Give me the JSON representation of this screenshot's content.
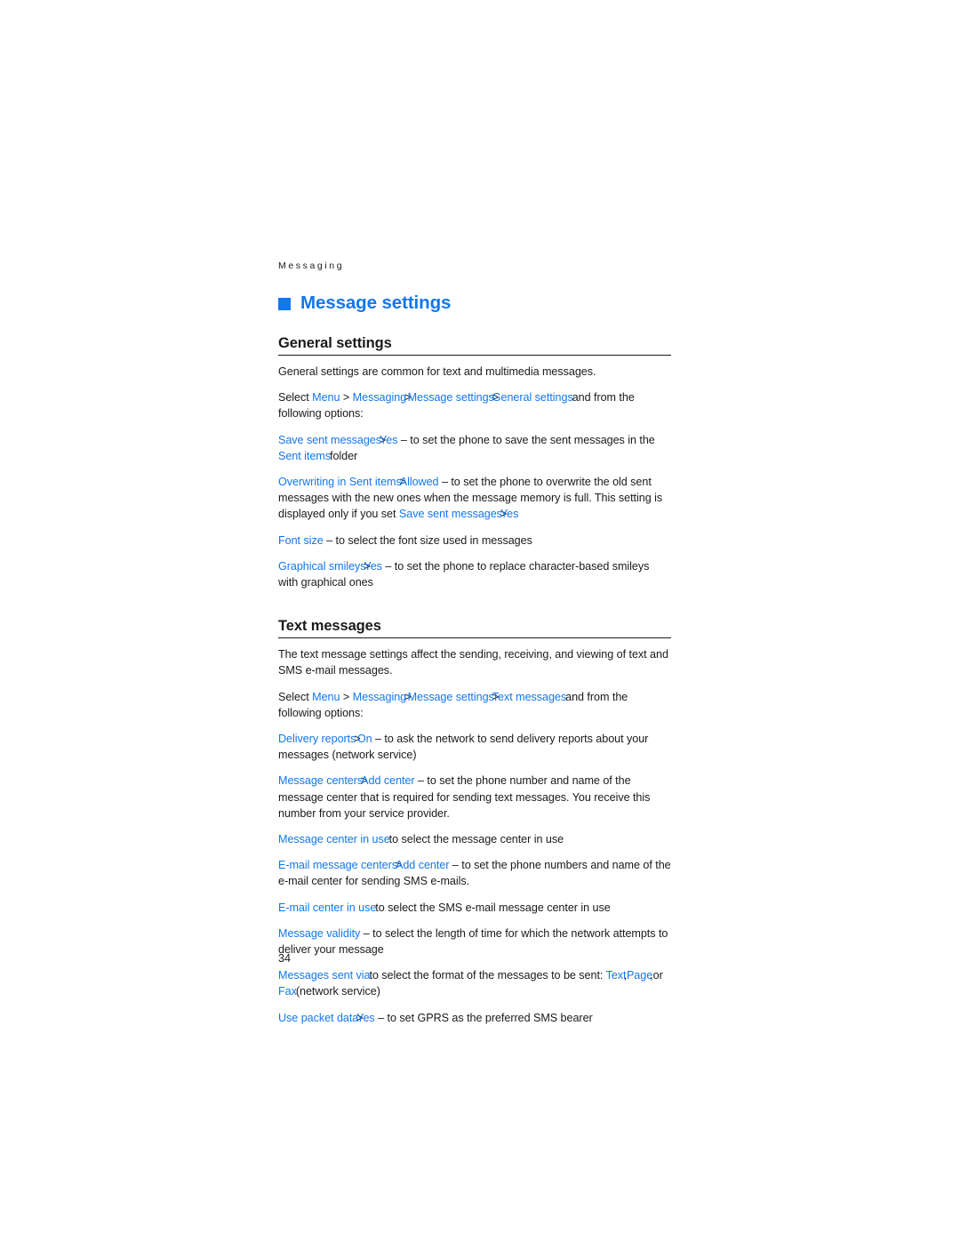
{
  "page": {
    "running_head": "Messaging",
    "page_number": "34",
    "accent_color": "#1277ee",
    "text_color": "#1a1a1a",
    "background_color": "#ffffff"
  },
  "chapter": {
    "bullet": "square-bullet",
    "title": "Message settings"
  },
  "sections": [
    {
      "heading": "General settings",
      "paragraphs": [
        {
          "id": "general-intro",
          "runs": [
            {
              "style": "plain",
              "text": "General settings are common for text and multimedia messages."
            }
          ]
        },
        {
          "id": "general-path",
          "runs": [
            {
              "style": "plain",
              "text": "Select "
            },
            {
              "style": "term",
              "text": "Menu"
            },
            {
              "style": "plain",
              "text": " > "
            },
            {
              "style": "term",
              "text": "Messaging"
            },
            {
              "style": "sep",
              "text": ">"
            },
            {
              "style": "term",
              "text": " Message settings"
            },
            {
              "style": "sep",
              "text": ">"
            },
            {
              "style": "term",
              "text": "General settings"
            },
            {
              "style": "collide",
              "text": "and from the following options:"
            }
          ]
        },
        {
          "id": "save-sent-messages",
          "runs": [
            {
              "style": "term",
              "text": "Save sent messages"
            },
            {
              "style": "sep",
              "text": ">"
            },
            {
              "style": "term",
              "text": "Yes"
            },
            {
              "style": "plain",
              "text": " – to set the phone to save the sent messages in the "
            },
            {
              "style": "term",
              "text": "Sent items"
            },
            {
              "style": "collide",
              "text": "folder"
            }
          ]
        },
        {
          "id": "overwriting-in-sent-items",
          "runs": [
            {
              "style": "term",
              "text": "Overwriting in Sent items"
            },
            {
              "style": "sep",
              "text": ">"
            },
            {
              "style": "term",
              "text": "Allowed"
            },
            {
              "style": "plain",
              "text": " – to set the phone to overwrite the old sent messages with the new ones when the message memory is full. This setting is displayed only if you set "
            },
            {
              "style": "term",
              "text": "Save sent messages"
            },
            {
              "style": "sep",
              "text": ">"
            },
            {
              "style": "term",
              "text": "Yes"
            }
          ]
        },
        {
          "id": "font-size",
          "runs": [
            {
              "style": "term",
              "text": "Font size"
            },
            {
              "style": "plain",
              "text": " – to select the font size used in messages"
            }
          ]
        },
        {
          "id": "graphical-smileys",
          "runs": [
            {
              "style": "term",
              "text": "Graphical smileys"
            },
            {
              "style": "sep",
              "text": ">"
            },
            {
              "style": "term",
              "text": "Yes"
            },
            {
              "style": "plain",
              "text": " – to set the phone to replace character-based smileys with graphical ones"
            }
          ]
        }
      ]
    },
    {
      "heading": "Text messages",
      "paragraphs": [
        {
          "id": "text-intro",
          "runs": [
            {
              "style": "plain",
              "text": "The text message settings affect the sending, receiving, and viewing of text and SMS e-mail messages."
            }
          ]
        },
        {
          "id": "text-path",
          "runs": [
            {
              "style": "plain",
              "text": "Select "
            },
            {
              "style": "term",
              "text": "Menu"
            },
            {
              "style": "plain",
              "text": " > "
            },
            {
              "style": "term",
              "text": "Messaging"
            },
            {
              "style": "sep",
              "text": ">"
            },
            {
              "style": "term",
              "text": " Message settings"
            },
            {
              "style": "sep",
              "text": ">"
            },
            {
              "style": "term",
              "text": "Text messages"
            },
            {
              "style": "collide",
              "text": "and from the following options:"
            }
          ]
        },
        {
          "id": "delivery-reports",
          "runs": [
            {
              "style": "term",
              "text": "Delivery reports"
            },
            {
              "style": "sep",
              "text": ">"
            },
            {
              "style": "term",
              "text": " On"
            },
            {
              "style": "plain",
              "text": " – to ask the network to send delivery reports about your messages (network service)"
            }
          ]
        },
        {
          "id": "message-centers",
          "runs": [
            {
              "style": "term",
              "text": "Message centers"
            },
            {
              "style": "sep",
              "text": ">"
            },
            {
              "style": "term",
              "text": "Add center"
            },
            {
              "style": "plain",
              "text": " – to set the phone number and name of the message center that is required for sending text messages. You receive this number from your service provider."
            }
          ]
        },
        {
          "id": "message-center-in-use",
          "runs": [
            {
              "style": "term",
              "text": "Message center in use"
            },
            {
              "style": "collide",
              "text": "to select the message center in use"
            }
          ]
        },
        {
          "id": "email-message-centers",
          "runs": [
            {
              "style": "term",
              "text": "E-mail message centers"
            },
            {
              "style": "sep",
              "text": ">"
            },
            {
              "style": "term",
              "text": "Add center"
            },
            {
              "style": "plain",
              "text": " – to set the phone numbers and name of the e-mail center for sending SMS e-mails."
            }
          ]
        },
        {
          "id": "email-center-in-use",
          "runs": [
            {
              "style": "term",
              "text": "E-mail center in use"
            },
            {
              "style": "collide",
              "text": "to select the SMS e-mail message center in use"
            }
          ]
        },
        {
          "id": "message-validity",
          "runs": [
            {
              "style": "term",
              "text": "Message validity"
            },
            {
              "style": "plain",
              "text": " – to select the length of time for which the network attempts to deliver your message"
            }
          ]
        },
        {
          "id": "messages-sent-via",
          "runs": [
            {
              "style": "term",
              "text": "Messages sent via"
            },
            {
              "style": "collide",
              "text": "to select the format of the messages to be sent: "
            },
            {
              "style": "term",
              "text": "Text"
            },
            {
              "style": "sepc",
              "text": ","
            },
            {
              "style": "term",
              "text": " Page"
            },
            {
              "style": "sepc",
              "text": ","
            },
            {
              "style": "plain",
              "text": " or "
            },
            {
              "style": "term",
              "text": "Fax"
            },
            {
              "style": "collide",
              "text": "(network service)"
            }
          ]
        },
        {
          "id": "use-packet-data",
          "runs": [
            {
              "style": "term",
              "text": "Use packet data"
            },
            {
              "style": "sep",
              "text": ">"
            },
            {
              "style": "term",
              "text": "Yes"
            },
            {
              "style": "plain",
              "text": " – to set GPRS as the preferred SMS bearer"
            }
          ]
        }
      ]
    }
  ]
}
